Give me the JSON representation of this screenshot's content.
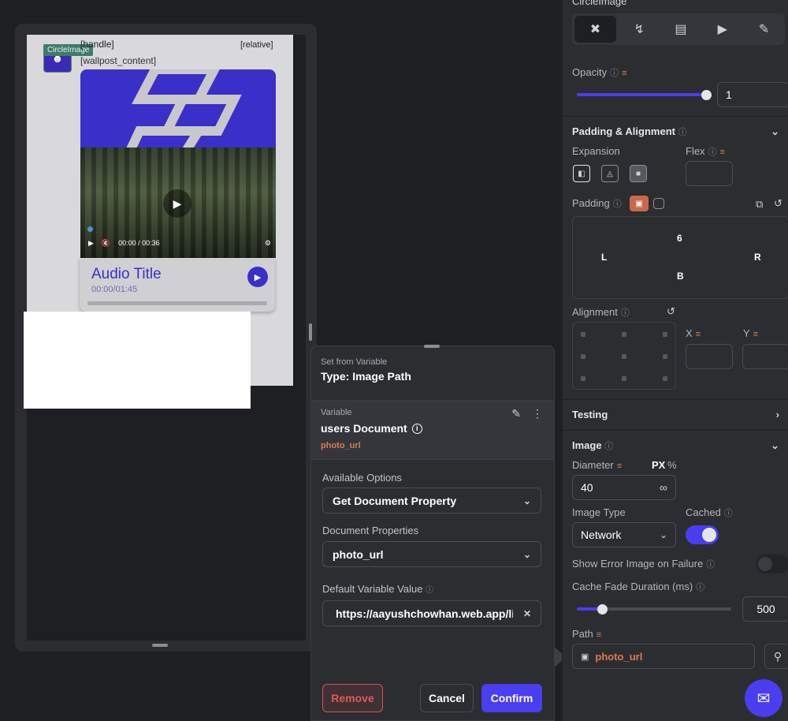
{
  "canvas": {
    "handle": "[handle]",
    "relative": "[relative]",
    "wallpost": "[wallpost_content]",
    "circle_tag": "CircleImage",
    "video_time": "00:00 / 00:36",
    "audio_title": "Audio Title",
    "audio_time": "00:00/01:45"
  },
  "popup": {
    "header_label": "Set from Variable",
    "type_title": "Type: Image Path",
    "variable_label": "Variable",
    "variable_name": "users Document",
    "variable_sub": "photo_url",
    "available_options_label": "Available Options",
    "available_options_value": "Get Document Property",
    "document_properties_label": "Document Properties",
    "document_properties_value": "photo_url",
    "default_value_label": "Default Variable Value",
    "default_value": "https://aayushchowhan.web.app/li",
    "remove_label": "Remove",
    "cancel_label": "Cancel",
    "confirm_label": "Confirm"
  },
  "panel": {
    "top_title": "CircleImage",
    "opacity_label": "Opacity",
    "opacity_value": "1",
    "opacity_fraction": 1.0,
    "padding_alignment_label": "Padding & Alignment",
    "expansion_label": "Expansion",
    "flex_label": "Flex",
    "padding_label": "Padding",
    "pad_top": "6",
    "pad_left": "L",
    "pad_right": "R",
    "pad_bottom": "B",
    "alignment_label": "Alignment",
    "x_label": "X",
    "y_label": "Y",
    "testing_label": "Testing",
    "image_label": "Image",
    "diameter_label": "Diameter",
    "px_label": "PX",
    "percent_label": "%",
    "diameter_value": "40",
    "image_type_label": "Image Type",
    "image_type_value": "Network",
    "cached_label": "Cached",
    "show_error_label": "Show Error Image on Failure",
    "cache_fade_label": "Cache Fade Duration (ms)",
    "cache_fade_value": "500",
    "path_label": "Path",
    "path_value": "photo_url"
  },
  "colors": {
    "accent": "#4b3df0",
    "variable_orange": "#e07a4f",
    "remove_red": "#e05a52"
  }
}
